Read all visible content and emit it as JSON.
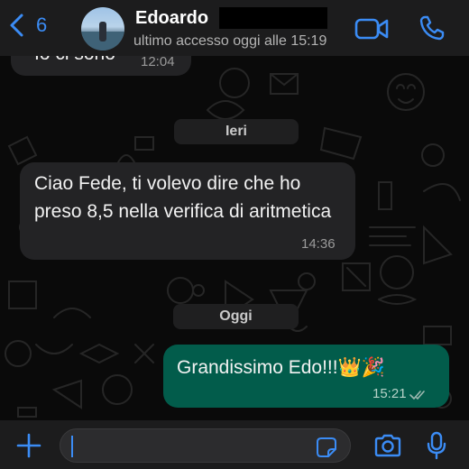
{
  "header": {
    "back_count": "6",
    "contact_name": "Edoardo",
    "last_seen": "ultimo accesso oggi alle 15:19"
  },
  "messages": [
    {
      "direction": "in",
      "text": "Io ci sono",
      "time": "12:04"
    },
    {
      "direction": "in",
      "text": "Ciao Fede, ti volevo dire che ho preso 8,5 nella verifica di aritmetica",
      "time": "14:36"
    },
    {
      "direction": "out",
      "text": "Grandissimo Edo!!!👑🎉",
      "time": "15:21",
      "status": "read"
    }
  ],
  "day_separators": [
    "Ieri",
    "Oggi"
  ],
  "input": {
    "placeholder": ""
  },
  "icons": {
    "back": "chevron-left-icon",
    "video": "video-camera-icon",
    "call": "phone-icon",
    "attach": "plus-icon",
    "sticker": "sticker-icon",
    "camera": "camera-icon",
    "mic": "microphone-icon",
    "read_receipt": "double-check-icon"
  },
  "colors": {
    "accent": "#3b8cf5",
    "incoming_bubble": "#232325",
    "outgoing_bubble": "#025c4b",
    "header_bg": "#1c1c1d"
  }
}
